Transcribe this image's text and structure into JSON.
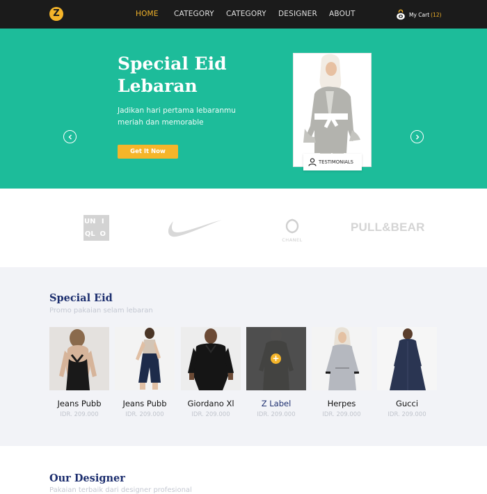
{
  "nav": {
    "logo": "Z",
    "links": [
      "HOME",
      "CATEGORY",
      "CATEGORY",
      "DESIGNER",
      "ABOUT"
    ],
    "cart_label": "My Cart",
    "cart_count": "(12)"
  },
  "hero": {
    "title": "Special Eid Lebaran",
    "subtitle": "Jadikan hari pertama lebaranmu meriah dan memorable",
    "button": "Get It Now",
    "testimonial": "TESTIMONIALS"
  },
  "brands": {
    "uniqlo": [
      "UN",
      "I",
      "QL",
      "O"
    ],
    "chanel": "CHANEL",
    "pullbear": "PULL&BEAR"
  },
  "special_eid": {
    "title": "Special Eid",
    "subtitle": "Promo pakaian selam lebaran",
    "products": [
      {
        "name": "Jeans Pubb",
        "price": "IDR. 209.000"
      },
      {
        "name": "Jeans Pubb",
        "price": "IDR. 209.000"
      },
      {
        "name": "Giordano Xl",
        "price": "IDR. 209.000"
      },
      {
        "name": "Z Label",
        "price": "IDR. 209.000"
      },
      {
        "name": "Herpes",
        "price": "IDR. 209.000"
      },
      {
        "name": "Gucci",
        "price": "IDR. 209.000"
      }
    ]
  },
  "designer": {
    "title": "Our Designer",
    "subtitle": "Pakaian terbaik dari designer profesional"
  },
  "colors": {
    "accent": "#f5b52a",
    "hero_bg": "#1dbc9a",
    "navy": "#1c2e6e",
    "nav_bg": "#1b1b1b"
  }
}
